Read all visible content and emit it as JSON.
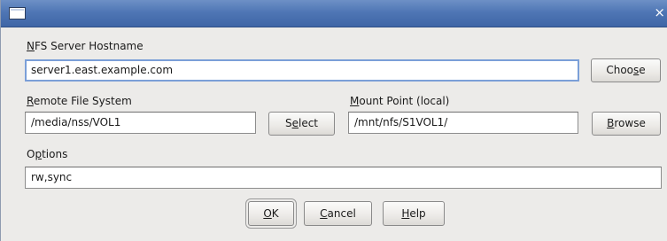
{
  "window": {
    "close_glyph": "×"
  },
  "hostname": {
    "label_accel": "N",
    "label_rest": "FS Server Hostname",
    "value": "server1.east.example.com",
    "button_pre": "Choo",
    "button_accel": "s",
    "button_post": "e"
  },
  "remote_fs": {
    "label_accel": "R",
    "label_rest": "emote File System",
    "value": "/media/nss/VOL1",
    "button_pre": "S",
    "button_accel": "e",
    "button_post": "lect"
  },
  "mount_point": {
    "label_accel": "M",
    "label_rest": "ount Point (local)",
    "value": "/mnt/nfs/S1VOL1/",
    "button_accel": "B",
    "button_post": "rowse"
  },
  "options": {
    "label_pre": "O",
    "label_accel": "p",
    "label_post": "tions",
    "value": "rw,sync"
  },
  "dialog_buttons": {
    "ok_accel": "O",
    "ok_post": "K",
    "cancel_accel": "C",
    "cancel_post": "ancel",
    "help_accel": "H",
    "help_post": "elp"
  },
  "colors": {
    "titlebar": "#4f76b5",
    "background": "#ecebe9",
    "focus_border": "#7b9fd8"
  }
}
